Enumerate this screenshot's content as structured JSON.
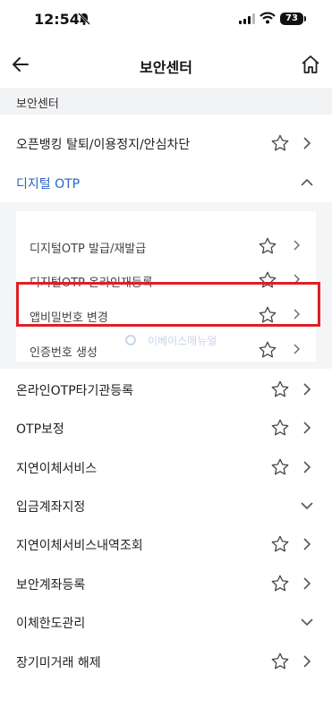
{
  "status": {
    "time": "12:54",
    "battery": "73"
  },
  "nav": {
    "title": "보안센터"
  },
  "section": {
    "header": "보안센터"
  },
  "menu": {
    "open_banking": "오픈뱅킹 탈퇴/이용정지/안심차단",
    "digital_otp": "디지털 OTP",
    "online_otp": "온라인OTP타기관등록",
    "otp_protect": "OTP보정",
    "delayed_transfer": "지연이체서비스",
    "deposit_account": "입금계좌지정",
    "delayed_history": "지연이체서비스내역조회",
    "security_account": "보안계좌등록",
    "transfer_limit": "이체한도관리",
    "dormant_release": "장기미거래 해제"
  },
  "digital_otp_sub": {
    "issue": "디지털OTP 발급/재발급",
    "reregister": "디지털OTP 온라인재등록",
    "change_pin": "앱비밀번호 변경",
    "auth_create": "인증번호 생성"
  },
  "watermark": "이베이스매뉴얼",
  "colors": {
    "accent_blue": "#2b62c7",
    "highlight_red": "#e01e25"
  }
}
